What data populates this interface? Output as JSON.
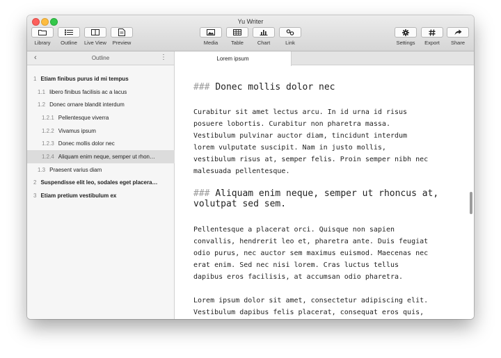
{
  "window": {
    "title": "Yu Writer"
  },
  "toolbar": {
    "library": "Library",
    "outline": "Outline",
    "live_view": "Live View",
    "preview": "Preview",
    "media": "Media",
    "table": "Table",
    "chart": "Chart",
    "link": "Link",
    "settings": "Settings",
    "export": "Export",
    "share": "Share"
  },
  "sidebar": {
    "title": "Outline",
    "back_glyph": "‹",
    "menu_glyph": "⋮",
    "items": [
      {
        "num": "1",
        "label": "Etiam finibus purus id mi tempus"
      },
      {
        "num": "1.1",
        "label": "libero finibus facilisis ac a lacus"
      },
      {
        "num": "1.2",
        "label": "Donec ornare blandit interdum"
      },
      {
        "num": "1.2.1",
        "label": "Pellentesque viverra"
      },
      {
        "num": "1.2.2",
        "label": "Vivamus ipsum"
      },
      {
        "num": "1.2.3",
        "label": "Donec mollis dolor nec"
      },
      {
        "num": "1.2.4",
        "label": "Aliquam enim neque, semper ut rhon…"
      },
      {
        "num": "1.3",
        "label": "Praesent varius diam"
      },
      {
        "num": "2",
        "label": "Suspendisse elit leo, sodales eget placera…"
      },
      {
        "num": "3",
        "label": "Etiam pretium vestibulum ex"
      }
    ]
  },
  "editor": {
    "tab_title": "Lorem ipsum",
    "heading_marker": "###",
    "heading1": "Donec mollis dolor nec",
    "para1": "Curabitur sit amet lectus arcu. In id urna id risus\nposuere lobortis. Curabitur non pharetra massa.\nVestibulum pulvinar auctor diam, tincidunt interdum\nlorem vulputate suscipit. Nam in justo mollis,\nvestibulum risus at, semper felis. Proin semper nibh nec\nmalesuada pellentesque.",
    "heading2": "Aliquam enim neque, semper ut rhoncus at,\nvolutpat sed sem.",
    "para2": "Pellentesque a placerat orci. Quisque non sapien\nconvallis, hendrerit leo et, pharetra ante. Duis feugiat\nodio purus, nec auctor sem maximus euismod. Maecenas nec\nerat enim. Sed nec nisi lorem. Cras luctus tellus\ndapibus eros facilisis, at accumsan odio pharetra.",
    "para3": "Lorem ipsum dolor sit amet, consectetur adipiscing elit.\nVestibulum dapibus felis placerat, consequat eros quis,"
  }
}
